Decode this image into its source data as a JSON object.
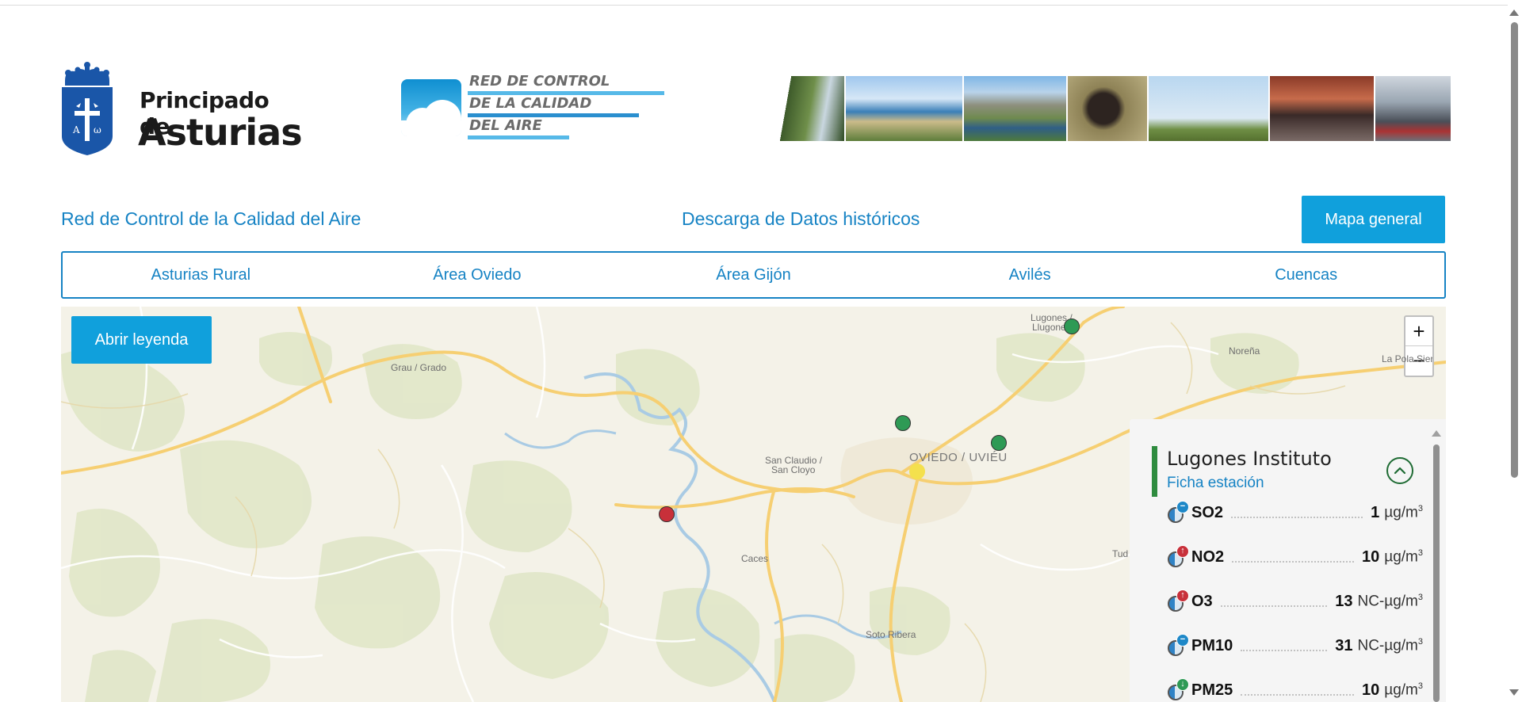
{
  "header": {
    "logo_line1": "Principado de",
    "logo_line2": "Asturias",
    "red_line1": "RED DE CONTROL",
    "red_line2": "DE LA CALIDAD",
    "red_line3": "DEL AIRE"
  },
  "nav": {
    "red_control": "Red de Control de la Calidad del Aire",
    "descarga": "Descarga de Datos históricos",
    "mapa_general": "Mapa general"
  },
  "areas": [
    "Asturias Rural",
    "Área Oviedo",
    "Área Gijón",
    "Avilés",
    "Cuencas"
  ],
  "map": {
    "legend_button": "Abrir leyenda",
    "zoom_in": "+",
    "zoom_out": "−",
    "places": {
      "grado": "Grau / Grado",
      "lugones_1": "Lugones /",
      "lugones_2": "Llugones",
      "norena": "Noreña",
      "la_pola": "La Pola Siero",
      "sanclaudio_1": "San Claudio /",
      "sanclaudio_2": "San Cloyo",
      "oviedo": "OVIEDO / UVIÉU",
      "caces": "Caces",
      "soto": "Soto Ribera",
      "tud": "Tud"
    },
    "marker_colors": {
      "good": "#2e9a55",
      "moderate": "#f4e04d",
      "bad": "#c8303a"
    }
  },
  "station": {
    "name": "Lugones Instituto",
    "ficha_link": "Ficha estación",
    "pollutants": [
      {
        "name": "SO2",
        "value": "1",
        "unit": "µg/m",
        "sup": "3",
        "trend": "−",
        "trend_color": "#1e88c8"
      },
      {
        "name": "NO2",
        "value": "10",
        "unit": "µg/m",
        "sup": "3",
        "trend": "↑",
        "trend_color": "#c8303a"
      },
      {
        "name": "O3",
        "value": "13",
        "unit": "NC-µg/m",
        "sup": "3",
        "trend": "↑",
        "trend_color": "#c8303a"
      },
      {
        "name": "PM10",
        "value": "31",
        "unit": "NC-µg/m",
        "sup": "3",
        "trend": "−",
        "trend_color": "#1e88c8"
      },
      {
        "name": "PM25",
        "value": "10",
        "unit": "µg/m",
        "sup": "3",
        "trend": "↓",
        "trend_color": "#2e9a55"
      }
    ]
  }
}
